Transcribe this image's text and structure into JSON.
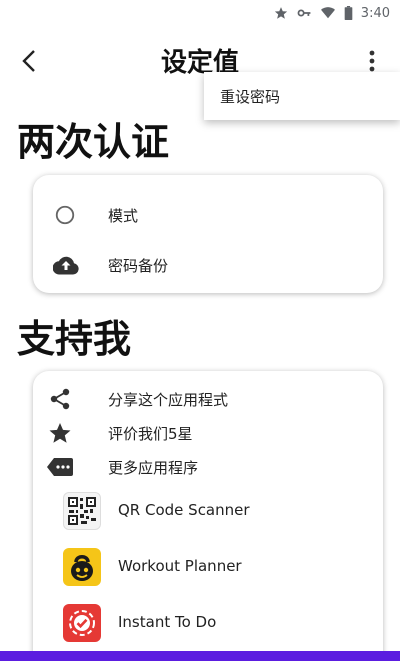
{
  "status": {
    "time": "3:40"
  },
  "app_bar": {
    "title": "设定值"
  },
  "menu": {
    "item": "重设密码"
  },
  "section_2fa": {
    "title": "两次认证",
    "items": [
      {
        "label": "模式",
        "icon": "radio-unchecked-icon"
      },
      {
        "label": "密码备份",
        "icon": "cloud-upload-icon"
      }
    ]
  },
  "section_support": {
    "title": "支持我",
    "items": [
      {
        "label": "分享这个应用程式",
        "icon": "share-icon"
      },
      {
        "label": "评价我们5星",
        "icon": "star-icon"
      },
      {
        "label": "更多应用程序",
        "icon": "more-apps-icon"
      }
    ],
    "apps": [
      {
        "name": "QR Code Scanner",
        "icon": "qr-code-icon"
      },
      {
        "name": "Workout Planner",
        "icon": "kettlebell-icon"
      },
      {
        "name": "Instant To Do",
        "icon": "checkmark-badge-icon"
      }
    ]
  },
  "colors": {
    "accent": "#5b1de0",
    "yellow": "#f5c518",
    "red": "#e53935"
  }
}
